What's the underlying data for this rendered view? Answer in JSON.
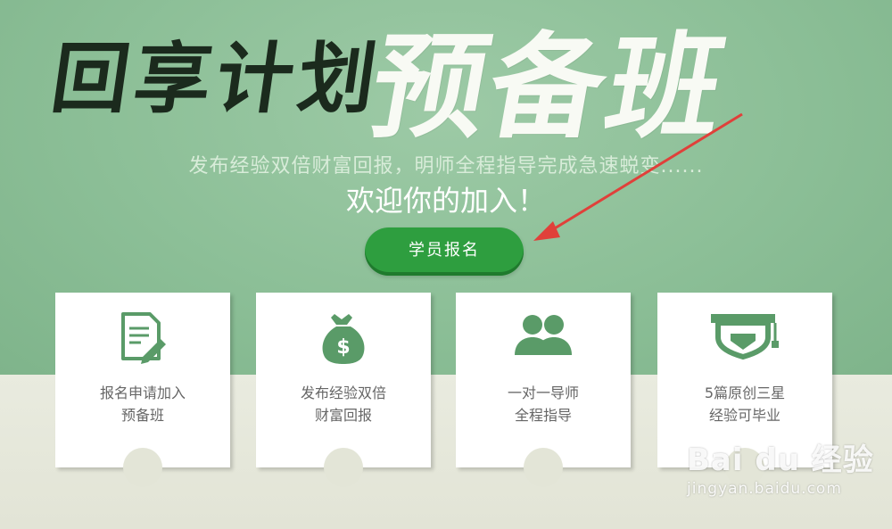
{
  "header": {
    "title_left": "回享计划",
    "title_right": "预备班",
    "subtitle": "发布经验双倍财富回报，明师全程指导完成急速蜕变......",
    "welcome": "欢迎你的加入！"
  },
  "cta": {
    "label": "学员报名"
  },
  "cards": [
    {
      "icon": "document-pen-icon",
      "line1": "报名申请加入",
      "line2": "预备班"
    },
    {
      "icon": "money-bag-icon",
      "line1": "发布经验双倍",
      "line2": "财富回报"
    },
    {
      "icon": "users-icon",
      "line1": "一对一导师",
      "line2": "全程指导"
    },
    {
      "icon": "graduation-cap-icon",
      "line1": "5篇原创三星",
      "line2": "经验可毕业"
    }
  ],
  "watermark": {
    "brand": "Bai du 经验",
    "url": "jingyan.baidu.com"
  },
  "colors": {
    "accent": "#2e9e3f",
    "icon": "#5a9b68",
    "arrow": "#e0403a"
  }
}
